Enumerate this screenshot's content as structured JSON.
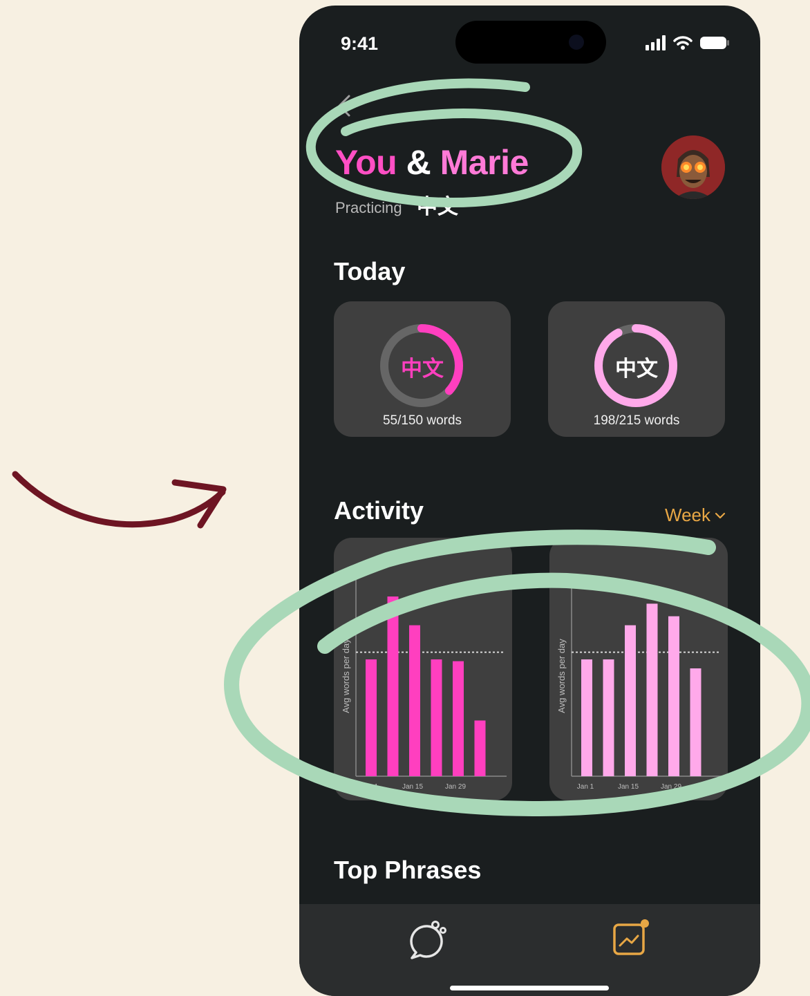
{
  "status": {
    "time": "9:41"
  },
  "header": {
    "title_you": "You",
    "title_amp": "&",
    "title_partner": "Marie",
    "subtitle": "Practicing",
    "language_label": "中文"
  },
  "today": {
    "heading": "Today",
    "cards": [
      {
        "label": "中文",
        "words": "55/150 words",
        "progress": 0.367,
        "color": "#ff3fbf"
      },
      {
        "label": "中文",
        "words": "198/215 words",
        "progress": 0.921,
        "color": "#ffa9ea"
      }
    ]
  },
  "activity": {
    "heading": "Activity",
    "period": "Week",
    "charts": [
      {
        "ylabel": "Avg words per day",
        "xticks": [
          "Jan 1",
          "Jan 15",
          "Jan 29"
        ],
        "color": "#ff3fbf",
        "values": [
          0.65,
          1.0,
          0.84,
          0.65,
          0.64,
          0.31
        ],
        "avg": 0.69
      },
      {
        "ylabel": "Avg words per day",
        "xticks": [
          "Jan 1",
          "Jan 15",
          "Jan 29"
        ],
        "color": "#ffa9ea",
        "values": [
          0.65,
          0.65,
          0.84,
          0.96,
          0.89,
          0.6
        ],
        "avg": 0.69
      }
    ]
  },
  "top_phrases": {
    "heading": "Top Phrases"
  },
  "tabbar": {
    "chat_icon": "chat-bubble-icon",
    "stats_icon": "chart-icon"
  },
  "colors": {
    "accent_pink": "#ff4fc4",
    "accent_light_pink": "#ff7ad7",
    "week_orange": "#e8a745",
    "annotation_green": "#a9d8b8",
    "arrow_red": "#6e1523",
    "background": "#f7f0e2"
  }
}
